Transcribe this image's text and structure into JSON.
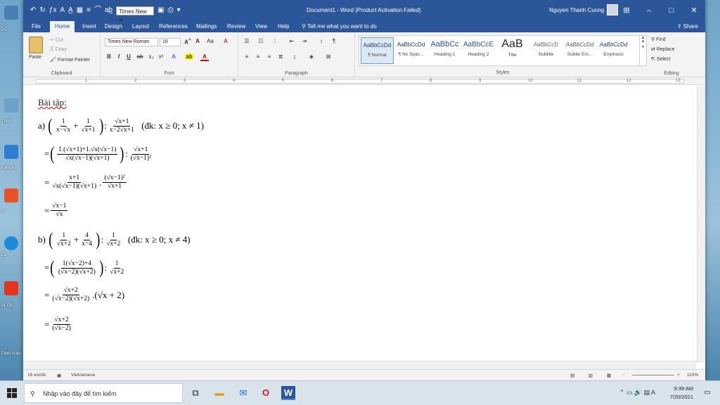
{
  "desktop": {
    "labels": [
      "PC",
      "Thùn",
      "Fanc Ki",
      "U",
      "Ze",
      "Ar Ch",
      "Oper crap"
    ]
  },
  "titlebar": {
    "font_name": "Times New R",
    "document_title": "Document1 - Word (Product Activation Failed)",
    "user_name": "Nguyen Thanh Cuong",
    "minimize": "–",
    "restore": "□",
    "close": "✕",
    "ribbon_display": "⊞"
  },
  "tabs": [
    "File",
    "Home",
    "Insert",
    "Design",
    "Layout",
    "References",
    "Mailings",
    "Review",
    "View",
    "Help"
  ],
  "tell_me": "Tell me what you want to do",
  "share": "Share",
  "ribbon": {
    "clipboard": {
      "paste": "Paste",
      "cut": "Cut",
      "copy": "Copy",
      "format_painter": "Format Painter",
      "label": "Clipboard"
    },
    "font": {
      "font_name": "Times New Roman",
      "font_size": "16",
      "label": "Font"
    },
    "paragraph": {
      "label": "Paragraph"
    },
    "styles": {
      "label": "Styles",
      "items": [
        {
          "preview": "AaBbCcDd",
          "name": "¶ Normal"
        },
        {
          "preview": "AaBbCcDd",
          "name": "¶ No Spac..."
        },
        {
          "preview": "AaBbCc",
          "name": "Heading 1"
        },
        {
          "preview": "AaBbCcE",
          "name": "Heading 2"
        },
        {
          "preview": "AaB",
          "name": "Title"
        },
        {
          "preview": "AaBbCcD",
          "name": "Subtitle"
        },
        {
          "preview": "AaBbCcDd",
          "name": "Subtle Em..."
        },
        {
          "preview": "AaBbCcDd",
          "name": "Emphasis"
        }
      ]
    },
    "editing": {
      "find": "Find",
      "replace": "Replace",
      "select": "Select",
      "label": "Editing"
    }
  },
  "ruler_numbers": [
    "1",
    "2",
    "3",
    "4",
    "5",
    "6",
    "7",
    "8",
    "9",
    "10",
    "11",
    "12",
    "13"
  ],
  "document": {
    "heading": "Bài tập:",
    "a_label": "a)",
    "a_cond": "(đk: x ≥ 0; x ≠ 1)",
    "b_label": "b)",
    "b_cond": "(đk: x ≥ 0; x ≠ 4)"
  },
  "status": {
    "words": "16 words",
    "language": "Vietnamese",
    "zoom": "110%"
  },
  "taskbar": {
    "search_placeholder": "Nhập vào đây để tìm kiếm",
    "time": "9:39 AM",
    "date": "7/20/2021"
  }
}
